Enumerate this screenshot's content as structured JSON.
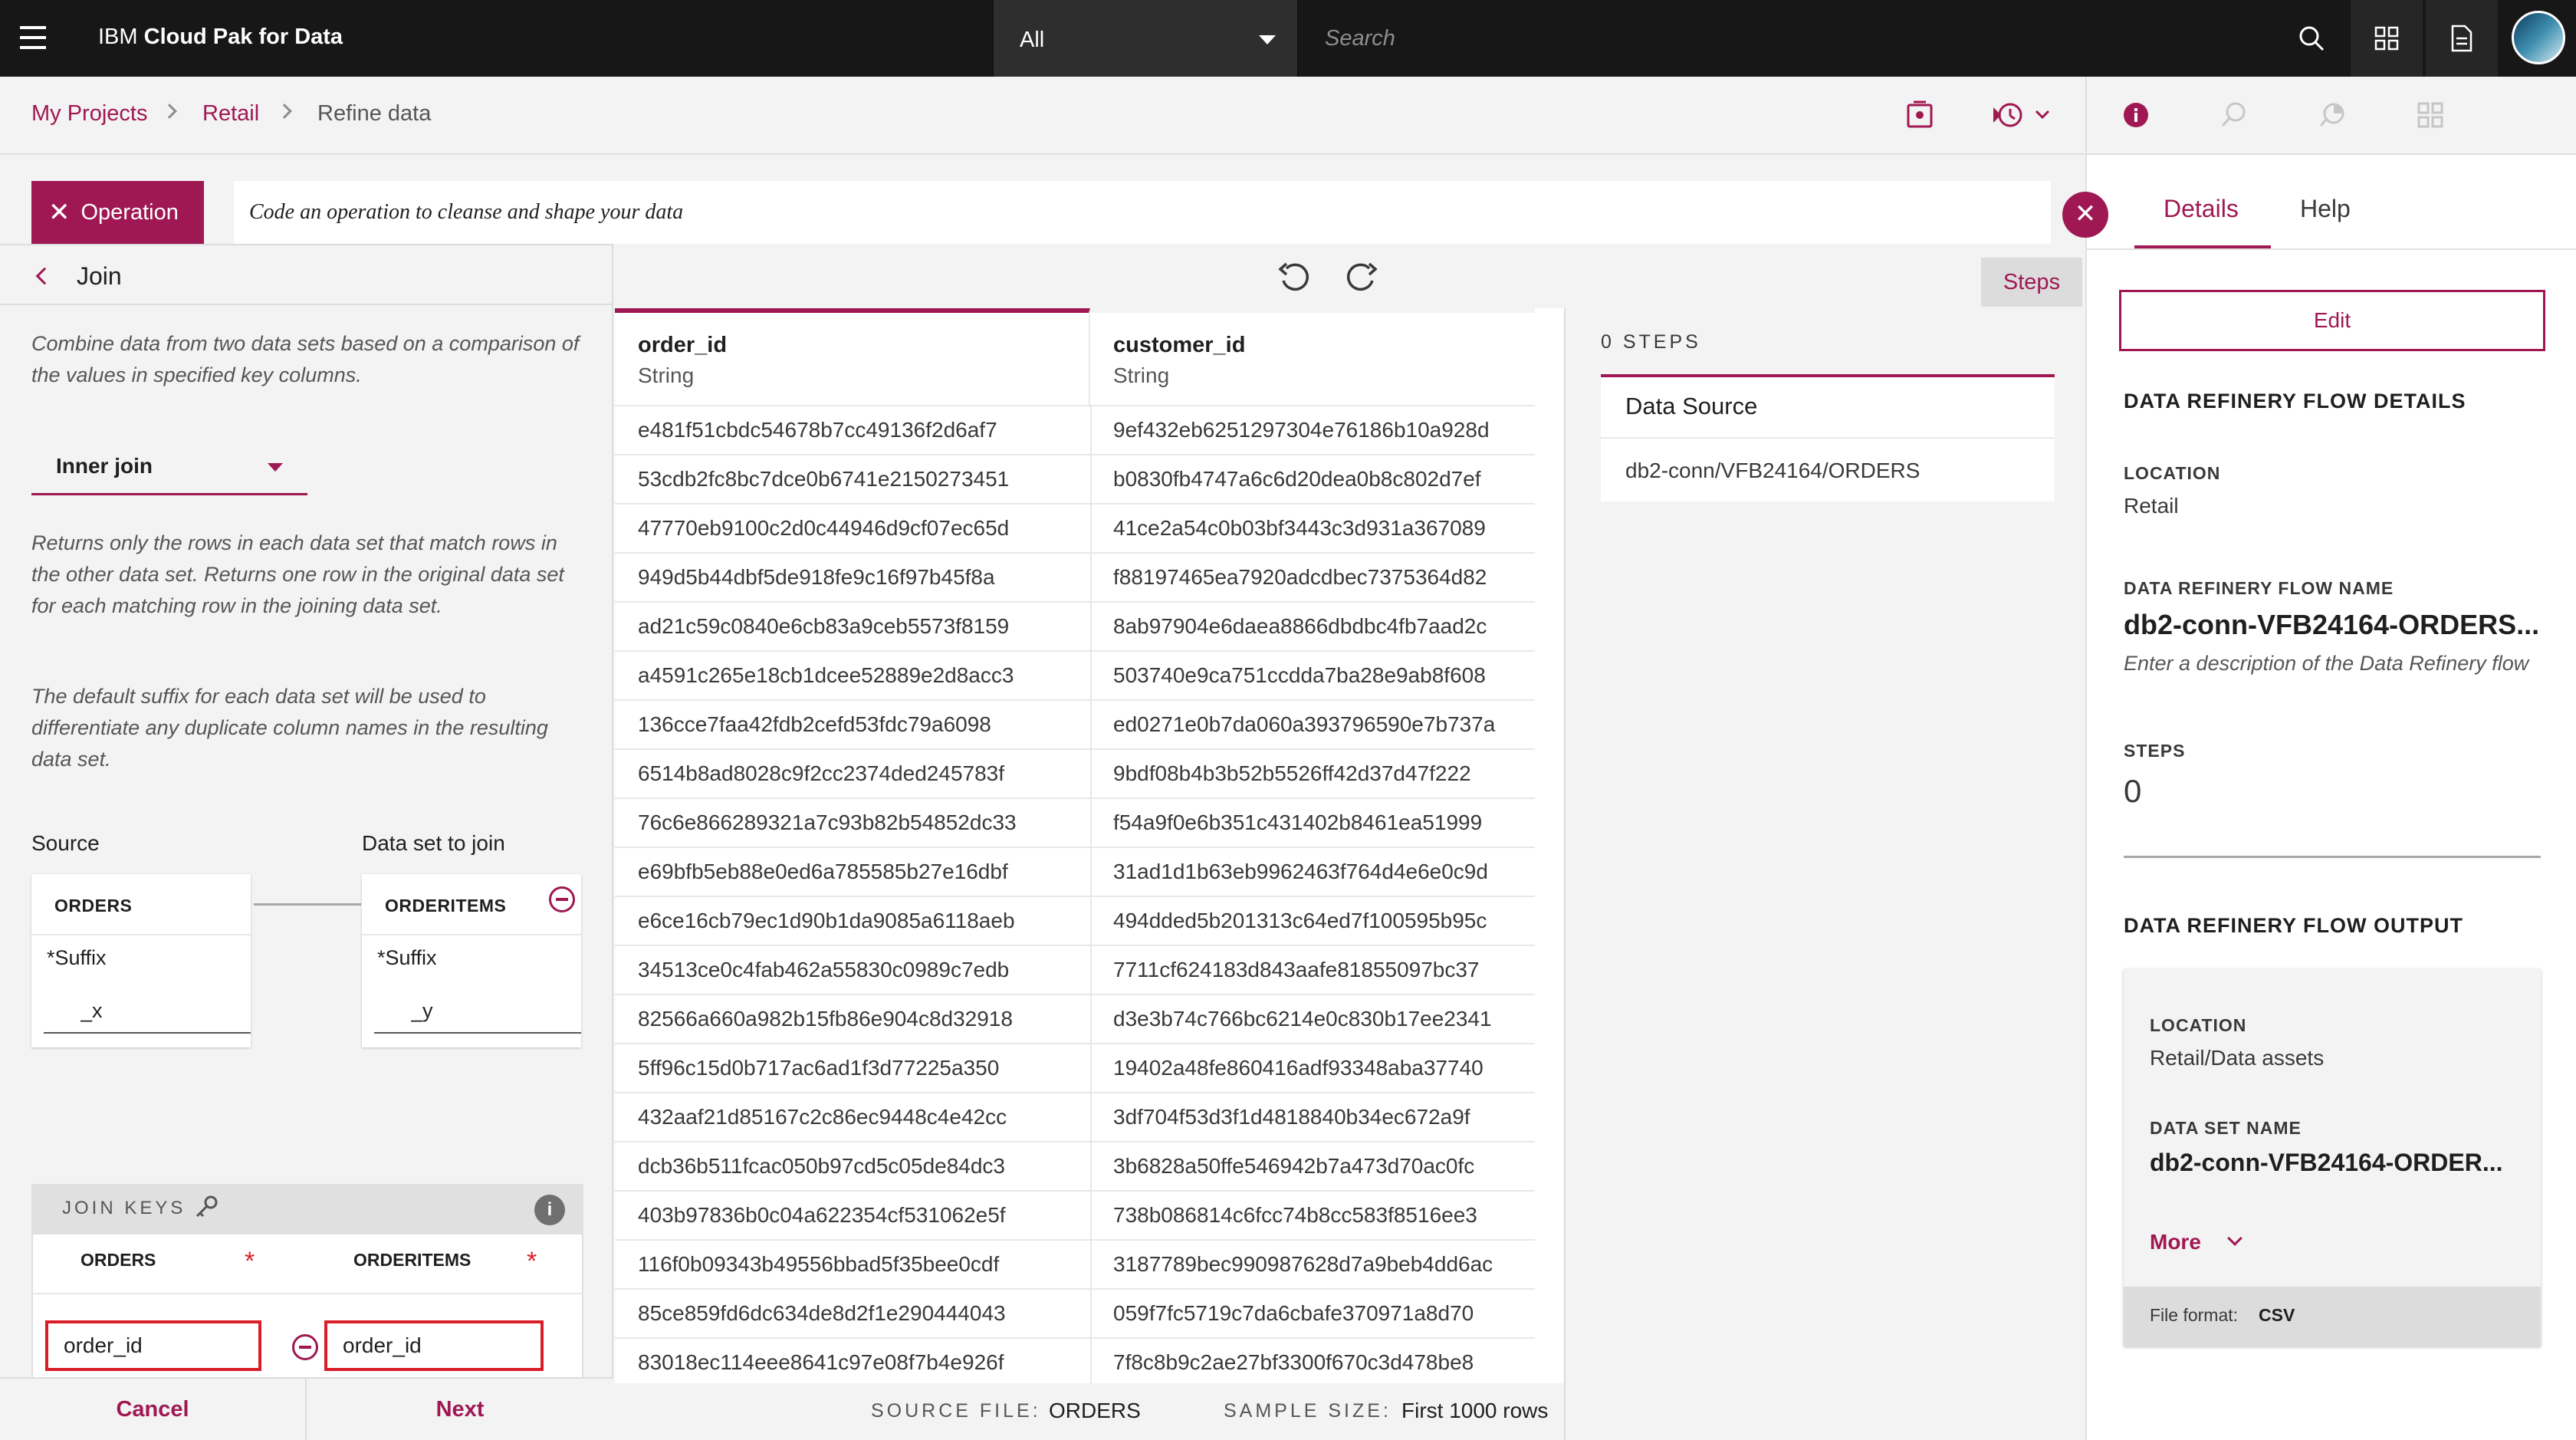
{
  "header": {
    "brand_prefix": "IBM",
    "brand_name": "Cloud Pak for Data",
    "scope_label": "All",
    "search_placeholder": "Search"
  },
  "breadcrumb": {
    "items": [
      "My Projects",
      "Retail",
      "Refine data"
    ]
  },
  "operation": {
    "button_label": "Operation",
    "code_placeholder": "Code an operation to cleanse and shape your data"
  },
  "join_panel": {
    "title": "Join",
    "description": "Combine data from two data sets based on a comparison of the values in specified key columns.",
    "join_type": "Inner join",
    "join_type_note": "Returns only the rows in each data set that match rows in the other data set. Returns one row in the original data set for each matching row in the joining data set.",
    "suffix_note": "The default suffix for each data set will be used to differentiate any duplicate column names in the resulting data set.",
    "source_heading": "Source",
    "join_heading": "Data set to join",
    "source": {
      "name": "ORDERS",
      "suffix_label": "*Suffix",
      "suffix_value": "_x"
    },
    "join_ds": {
      "name": "ORDERITEMS",
      "suffix_label": "*Suffix",
      "suffix_value": "_y"
    },
    "keys": {
      "title": "JOIN KEYS",
      "info": "i",
      "left_col": "ORDERS",
      "right_col": "ORDERITEMS",
      "required_mark": "*",
      "left_value": "order_id",
      "right_value": "order_id"
    },
    "cancel_label": "Cancel",
    "next_label": "Next"
  },
  "grid": {
    "columns": [
      {
        "name": "order_id",
        "type": "String"
      },
      {
        "name": "customer_id",
        "type": "String"
      }
    ],
    "rows": [
      [
        "e481f51cbdc54678b7cc49136f2d6af7",
        "9ef432eb6251297304e76186b10a928d"
      ],
      [
        "53cdb2fc8bc7dce0b6741e2150273451",
        "b0830fb4747a6c6d20dea0b8c802d7ef"
      ],
      [
        "47770eb9100c2d0c44946d9cf07ec65d",
        "41ce2a54c0b03bf3443c3d931a367089"
      ],
      [
        "949d5b44dbf5de918fe9c16f97b45f8a",
        "f88197465ea7920adcdbec7375364d82"
      ],
      [
        "ad21c59c0840e6cb83a9ceb5573f8159",
        "8ab97904e6daea8866dbdbc4fb7aad2c"
      ],
      [
        "a4591c265e18cb1dcee52889e2d8acc3",
        "503740e9ca751ccdda7ba28e9ab8f608"
      ],
      [
        "136cce7faa42fdb2cefd53fdc79a6098",
        "ed0271e0b7da060a393796590e7b737a"
      ],
      [
        "6514b8ad8028c9f2cc2374ded245783f",
        "9bdf08b4b3b52b5526ff42d37d47f222"
      ],
      [
        "76c6e866289321a7c93b82b54852dc33",
        "f54a9f0e6b351c431402b8461ea51999"
      ],
      [
        "e69bfb5eb88e0ed6a785585b27e16dbf",
        "31ad1d1b63eb9962463f764d4e6e0c9d"
      ],
      [
        "e6ce16cb79ec1d90b1da9085a6118aeb",
        "494dded5b201313c64ed7f100595b95c"
      ],
      [
        "34513ce0c4fab462a55830c0989c7edb",
        "7711cf624183d843aafe81855097bc37"
      ],
      [
        "82566a660a982b15fb86e904c8d32918",
        "d3e3b74c766bc6214e0c830b17ee2341"
      ],
      [
        "5ff96c15d0b717ac6ad1f3d77225a350",
        "19402a48fe860416adf93348aba37740"
      ],
      [
        "432aaf21d85167c2c86ec9448c4e42cc",
        "3df704f53d3f1d4818840b34ec672a9f"
      ],
      [
        "dcb36b511fcac050b97cd5c05de84dc3",
        "3b6828a50ffe546942b7a473d70ac0fc"
      ],
      [
        "403b97836b0c04a622354cf531062e5f",
        "738b086814c6fcc74b8cc583f8516ee3"
      ],
      [
        "116f0b09343b49556bbad5f35bee0cdf",
        "3187789bec990987628d7a9beb4dd6ac"
      ],
      [
        "85ce859fd6dc634de8d2f1e290444043",
        "059f7fc5719c7da6cbafe370971a8d70"
      ],
      [
        "83018ec114eee8641c97e08f7b4e926f",
        "7f8c8b9c2ae27bf3300f670c3d478be8"
      ]
    ],
    "footer": {
      "source_label": "SOURCE FILE:",
      "source_value": "ORDERS",
      "sample_label": "SAMPLE SIZE:",
      "sample_value": "First 1000 rows"
    }
  },
  "steps_panel": {
    "tab_label": "Steps",
    "count_label": "0 STEPS",
    "card_title": "Data Source",
    "card_path": "db2-conn/VFB24164/ORDERS"
  },
  "details": {
    "tabs": [
      "Details",
      "Help"
    ],
    "edit_label": "Edit",
    "flow_details_heading": "DATA REFINERY FLOW DETAILS",
    "location_label": "LOCATION",
    "location_value": "Retail",
    "flow_name_label": "DATA REFINERY FLOW NAME",
    "flow_name_value": "db2-conn-VFB24164-ORDERS...",
    "flow_desc_placeholder": "Enter a description of the Data Refinery flow",
    "steps_label": "STEPS",
    "steps_value": "0",
    "output_heading": "DATA REFINERY FLOW OUTPUT",
    "out_location_label": "LOCATION",
    "out_location_value": "Retail/Data assets",
    "dataset_name_label": "DATA SET NAME",
    "dataset_name_value": "db2-conn-VFB24164-ORDER...",
    "more_label": "More",
    "file_format_label": "File format:",
    "file_format_value": "CSV"
  },
  "colors": {
    "accent": "#9f1853",
    "topbar": "#171717",
    "error": "#da1e28"
  }
}
